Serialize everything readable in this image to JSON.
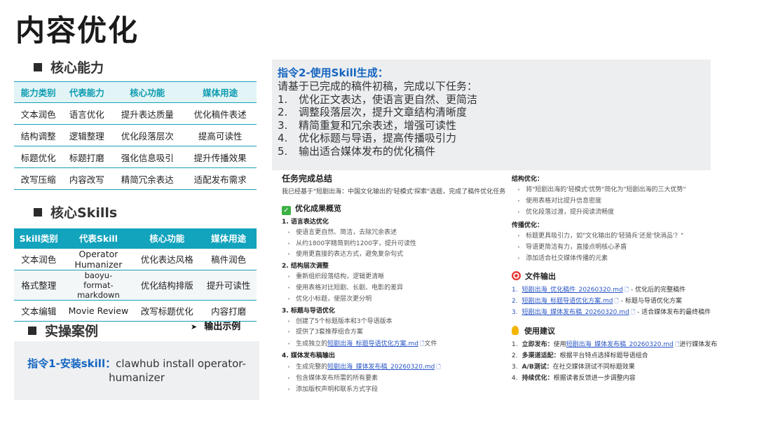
{
  "title": "内容优化",
  "core_capability": {
    "heading": "核心能力",
    "columns": [
      "能力类别",
      "代表能力",
      "核心功能",
      "媒体用途"
    ],
    "rows": [
      [
        "文本润色",
        "语言优化",
        "提升表达质量",
        "优化稿件表述"
      ],
      [
        "结构调整",
        "逻辑整理",
        "优化段落层次",
        "提高可读性"
      ],
      [
        "标题优化",
        "标题打磨",
        "强化信息吸引",
        "提升传播效果"
      ],
      [
        "改写压缩",
        "内容改写",
        "精简冗余表达",
        "适配发布需求"
      ]
    ]
  },
  "core_skills": {
    "heading": "核心Skills",
    "columns": [
      "Skill类别",
      "代表Skill",
      "核心功能",
      "媒体用途"
    ],
    "rows": [
      [
        "文本润色",
        "Operator Humanizer",
        "优化表达风格",
        "稿件润色"
      ],
      [
        "格式整理",
        "baoyu-format-markdown",
        "优化结构排版",
        "提升可读性"
      ],
      [
        "文本编辑",
        "Movie Review",
        "改写标题优化",
        "内容打磨"
      ]
    ]
  },
  "case": {
    "heading": "实操案例",
    "output_label": "输出示例",
    "cmd1_label": "指令1-安装skill：",
    "cmd1_text": "clawhub install operator-humanizer"
  },
  "cmd2": {
    "label": "指令2-使用Skill生成：",
    "intro": "请基于已完成的稿件初稿，完成以下任务：",
    "items": [
      {
        "n": "1.",
        "t": "优化正文表达，使语言更自然、更简洁"
      },
      {
        "n": "2.",
        "t": "调整段落层次，提升文章结构清晰度"
      },
      {
        "n": "3.",
        "t": "精简重复和冗余表述，增强可读性"
      },
      {
        "n": "4.",
        "t": "优化标题与导语，提高传播吸引力"
      },
      {
        "n": "5.",
        "t": "输出适合媒体发布的优化稿件"
      }
    ]
  },
  "result": {
    "title": "任务完成总结",
    "summary": "我已经基于\"短剧出海：中国文化输出的'轻模式'探索\"选题，完成了稿件优化任务",
    "overview_title": "优化成果概览",
    "sections": [
      {
        "title": "1. 语言表达优化",
        "items": [
          "使语言更自然、简洁，去除冗余表述",
          "从约1800字精简到约1200字，提升可读性",
          "使用更直接的表达方式，避免复杂句式"
        ]
      },
      {
        "title": "2. 结构层次调整",
        "items": [
          "重新组织段落结构，逻辑更清晰",
          "使用表格对比短剧、长剧、电影的差异",
          "优化小标题，使层次更分明"
        ]
      },
      {
        "title": "3. 标题与导语优化",
        "items": [
          "创建了5个标题版本和3个导语版本",
          "提供了3套推荐组合方案"
        ]
      }
    ],
    "sec3_link_prefix": "生成独立的",
    "sec3_link": "短剧出海_标题导语优化方案.md",
    "sec3_link_suffix": "文件",
    "sec4_title": "4. 媒体发布稿输出",
    "sec4_link_prefix": "生成完整的",
    "sec4_link": "短剧出海_媒体发布稿_20260320.md",
    "sec4_items": [
      "包含媒体发布所需的所有要素",
      "添加版权声明和联系方式字段"
    ],
    "structure_title": "结构优化：",
    "structure_items": [
      "将\"短剧出海的'轻模式'优势\"简化为\"短剧出海的三大优势\"",
      "使用表格对比提升信息密度",
      "优化段落过渡，提升阅读流畅度"
    ],
    "spread_title": "传播优化：",
    "spread_items": [
      "标题更具吸引力，如\"文化输出的'轻骑兵'还是'快消品'？\"",
      "导语更简洁有力，直接点明核心矛盾",
      "添加适合社交媒体传播的元素"
    ],
    "files_title": "文件输出",
    "files": [
      {
        "n": "1.",
        "name": "短剧出海_优化稿件_20260320.md",
        "desc": " - 优化后的完整稿件"
      },
      {
        "n": "2.",
        "name": "短剧出海_标题导语优化方案.md",
        "desc": " - 标题与导语优化方案"
      },
      {
        "n": "3.",
        "name": "短剧出海_媒体发布稿_20260320.md",
        "desc": " - 适合媒体发布的最终稿件"
      }
    ],
    "advice_title": "使用建议",
    "advice": [
      {
        "n": "1.",
        "k": "立即发布：",
        "pre": "使用",
        "link": "短剧出海_媒体发布稿_20260320.md",
        "post": "进行媒体发布"
      },
      {
        "n": "2.",
        "k": "多渠道适配：",
        "pre": "根据平台特点选择标题导语组合",
        "link": "",
        "post": ""
      },
      {
        "n": "3.",
        "k": "A/B测试：",
        "pre": "在社交媒体测试不同标题效果",
        "link": "",
        "post": ""
      },
      {
        "n": "4.",
        "k": "持续优化：",
        "pre": "根据读者反馈进一步调整内容",
        "link": "",
        "post": ""
      }
    ],
    "doc_icon": "document-icon"
  }
}
